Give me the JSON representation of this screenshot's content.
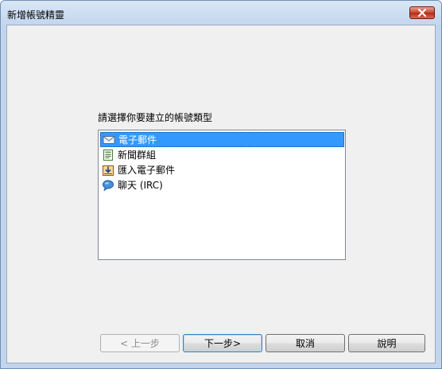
{
  "window": {
    "title": "新增帳號精靈"
  },
  "prompt": "請選擇你要建立的帳號類型",
  "account_types": [
    {
      "label": "電子郵件",
      "icon": "envelope-icon",
      "selected": true
    },
    {
      "label": "新聞群組",
      "icon": "newsgroup-icon",
      "selected": false
    },
    {
      "label": "匯入電子郵件",
      "icon": "import-mail-icon",
      "selected": false
    },
    {
      "label": "聊天 (IRC)",
      "icon": "chat-bubble-icon",
      "selected": false
    }
  ],
  "buttons": {
    "back": "< 上一步",
    "next": "下一步>",
    "cancel": "取消",
    "help": "說明"
  },
  "colors": {
    "selection": "#3399ff",
    "close_button": "#c7452f"
  }
}
